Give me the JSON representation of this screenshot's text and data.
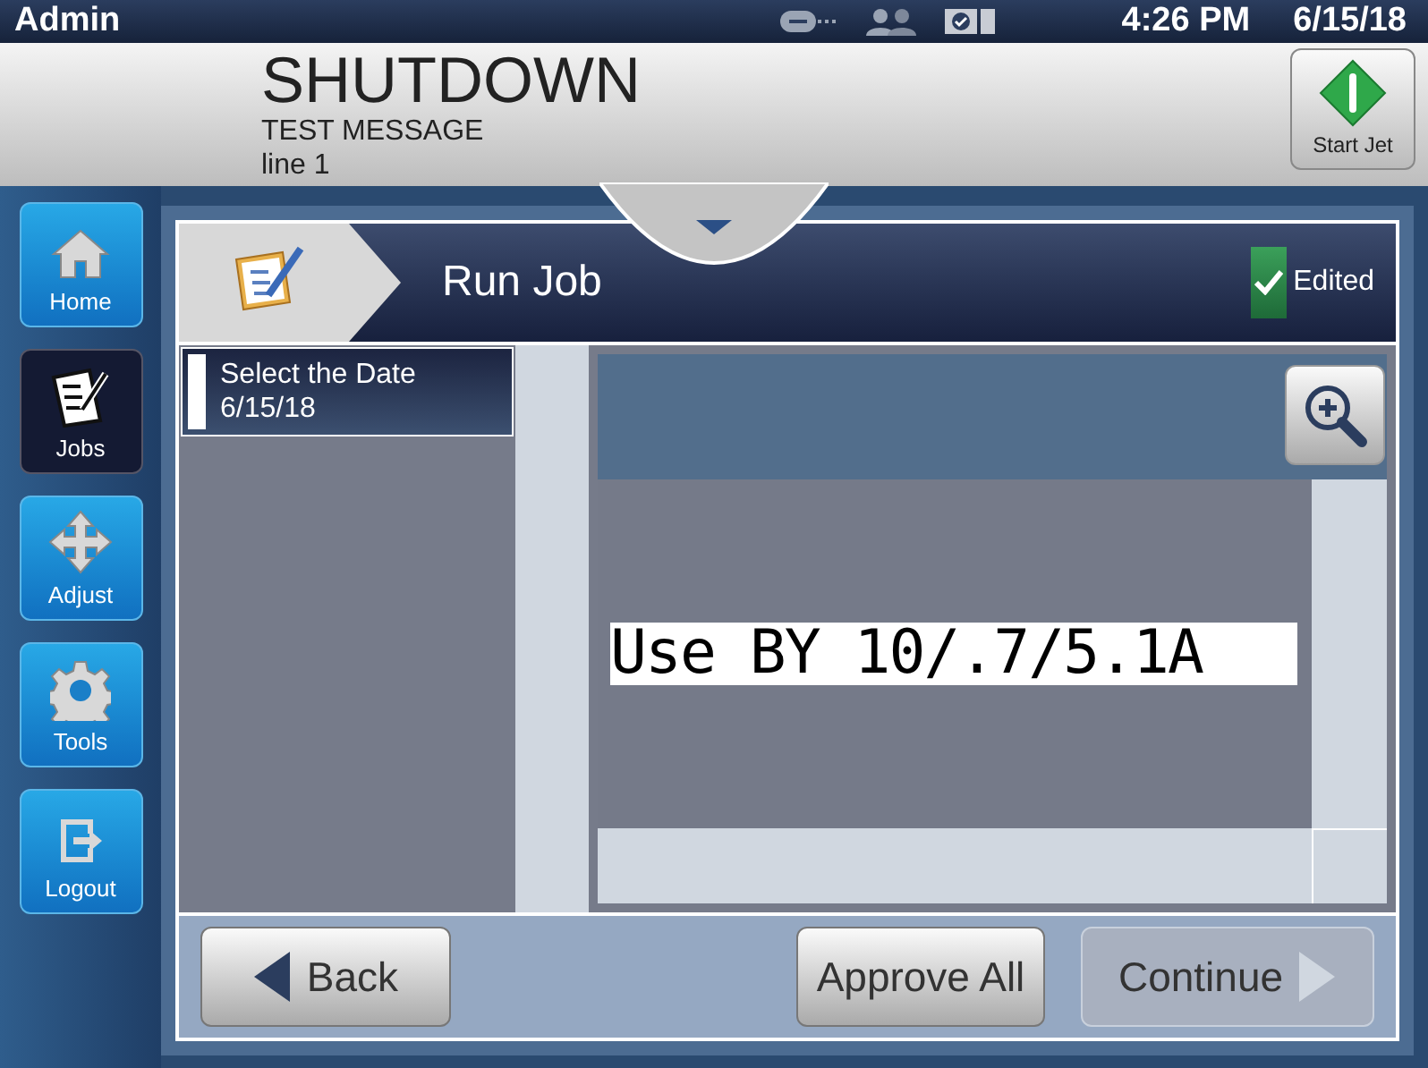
{
  "status_bar": {
    "user": "Admin",
    "time": "4:26 PM",
    "date": "6/15/18"
  },
  "header": {
    "state": "SHUTDOWN",
    "message": "TEST MESSAGE",
    "line": "line 1",
    "start_button": "Start Jet"
  },
  "nav": [
    {
      "label": "Home",
      "selected": false
    },
    {
      "label": "Jobs",
      "selected": true
    },
    {
      "label": "Adjust",
      "selected": false
    },
    {
      "label": "Tools",
      "selected": false
    },
    {
      "label": "Logout",
      "selected": false
    }
  ],
  "page": {
    "title": "Run Job",
    "edited": {
      "label": "Edited",
      "checked": true
    }
  },
  "fields": [
    {
      "label": "Select the Date",
      "value": "6/15/18",
      "selected": true
    }
  ],
  "preview": {
    "text": "Use BY 10/.7/5.1A"
  },
  "buttons": [
    {
      "label": "Back",
      "kind": "back",
      "disabled": false
    },
    {
      "label": "Approve All",
      "kind": "plain",
      "disabled": false
    },
    {
      "label": "Continue",
      "kind": "next",
      "disabled": true
    }
  ]
}
